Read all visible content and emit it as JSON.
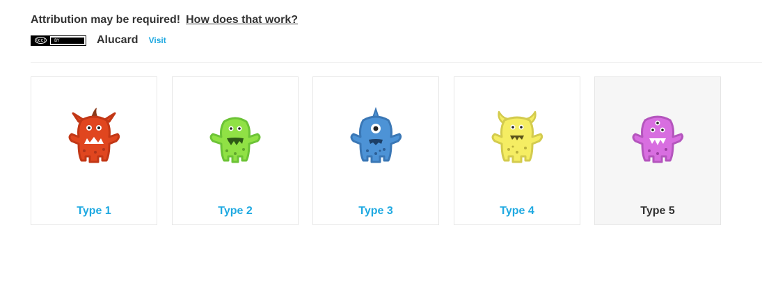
{
  "attribution": {
    "notice": "Attribution may be required!",
    "help_link": "How does that work?"
  },
  "license_badge": {
    "left_text": "(cc)",
    "right_text": "BY",
    "icon": "cc-by-badge"
  },
  "author": {
    "name": "Alucard",
    "visit_label": "Visit"
  },
  "colors": {
    "link": "#1fa9e1",
    "text": "#333333",
    "selected_card_bg": "#f6f6f6"
  },
  "types": [
    {
      "label": "Type 1",
      "icon": "red-horned-monster-icon",
      "body": "#e0461f",
      "outline": "#c23716",
      "selected": false
    },
    {
      "label": "Type 2",
      "icon": "green-monster-icon",
      "body": "#90e145",
      "outline": "#6cc336",
      "selected": false
    },
    {
      "label": "Type 3",
      "icon": "blue-cyclops-monster-icon",
      "body": "#4d93d6",
      "outline": "#3a77b5",
      "selected": false
    },
    {
      "label": "Type 4",
      "icon": "yellow-horned-monster-icon",
      "body": "#f5ed63",
      "outline": "#d3cb4e",
      "selected": false
    },
    {
      "label": "Type 5",
      "icon": "purple-three-eyed-monster-icon",
      "body": "#d86ee0",
      "outline": "#b455bd",
      "selected": true
    }
  ]
}
